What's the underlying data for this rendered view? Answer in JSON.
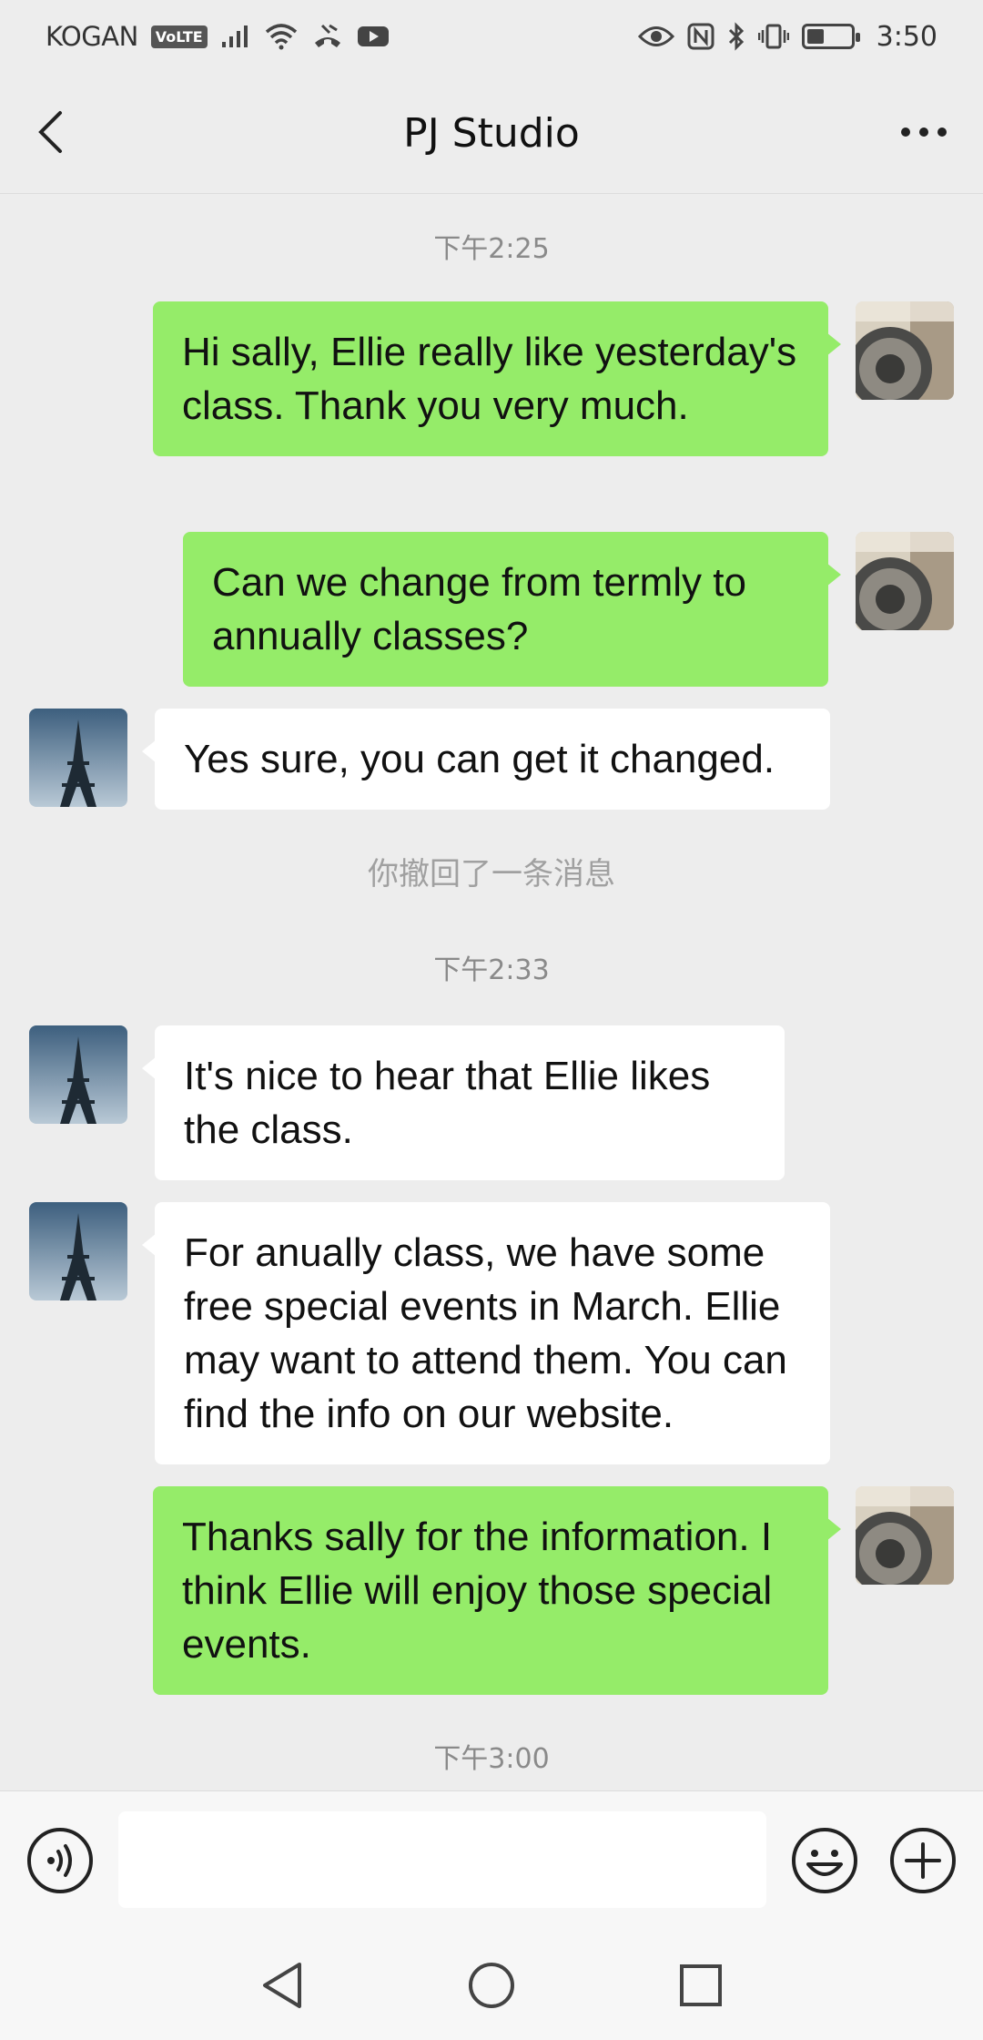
{
  "status_bar": {
    "carrier": "KOGAN",
    "volte": "VoLTE",
    "time": "3:50",
    "battery_level": 0.35,
    "icons": [
      "signal-icon",
      "wifi-icon",
      "call-icon",
      "youtube-icon",
      "eye-icon",
      "nfc-icon",
      "bluetooth-icon",
      "vibrate-icon",
      "battery-icon"
    ]
  },
  "header": {
    "title": "PJ Studio",
    "back_icon": "chevron-left-icon",
    "more_icon": "more-dots-icon"
  },
  "messages": {
    "time1": "下午2:25",
    "m1": "Hi sally, Ellie really like yesterday's class. Thank you very much.",
    "m2": "Can we change from termly to annually classes?",
    "m3": "Yes sure, you can get it changed.",
    "recall_notice": "你撤回了一条消息",
    "time2": "下午2:33",
    "m4": "It's nice to hear that Ellie likes the class.",
    "m5": "For anually class, we have some free special events in March. Ellie may want to attend them. You can find the info on our website.",
    "m6": "Thanks sally for the information. I think Ellie will enjoy those special events.",
    "time3": "下午3:00"
  },
  "input_bar": {
    "value": "",
    "icons": [
      "voice-icon",
      "emoji-icon",
      "plus-icon"
    ]
  },
  "nav_bar": {
    "icons": [
      "nav-back-icon",
      "nav-home-icon",
      "nav-recents-icon"
    ]
  },
  "colors": {
    "background": "#ededed",
    "my_bubble": "#95ec69",
    "their_bubble": "#ffffff",
    "timestamp": "#8a8a8a"
  }
}
